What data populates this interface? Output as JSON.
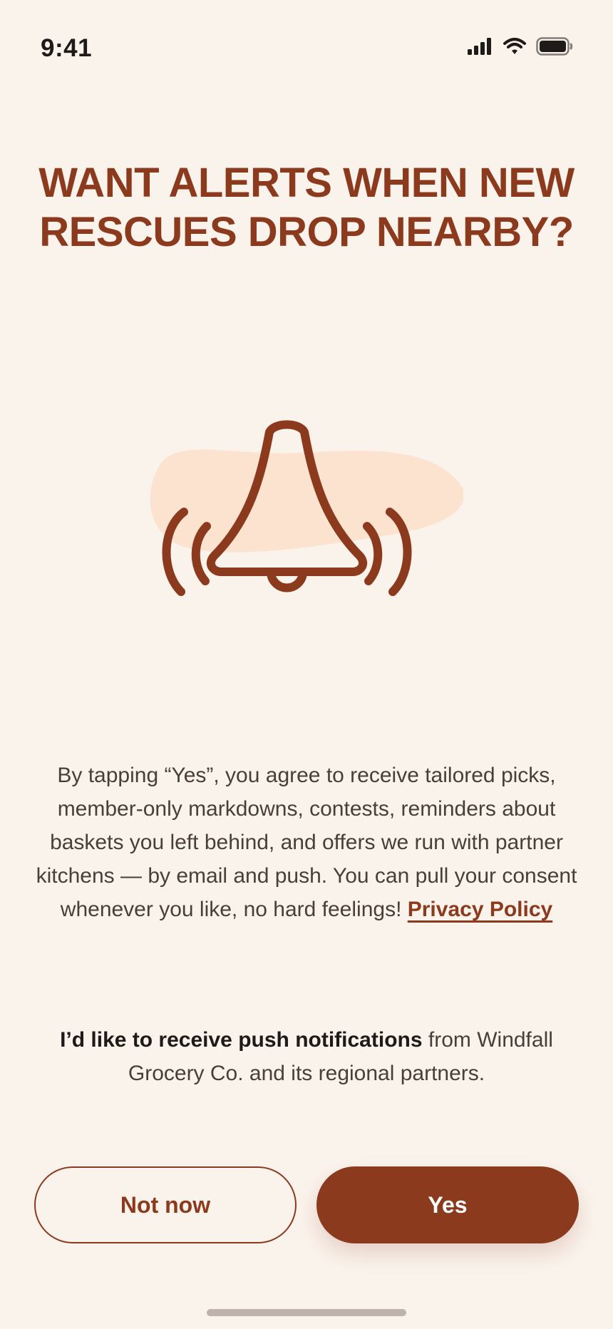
{
  "status_bar": {
    "time": "9:41",
    "icons": [
      "cellular-signal-icon",
      "wifi-icon",
      "battery-icon"
    ]
  },
  "title": "WANT ALERTS WHEN NEW RESCUES DROP NEARBY?",
  "illustration": {
    "icon": "bell-ringing-icon"
  },
  "consent": {
    "text": "By tapping “Yes”, you agree to receive tailored picks, member-only markdowns, contests, reminders about baskets you left behind, and offers we run with partner kitchens — by email and push. You can pull your consent whenever you like, no hard feelings!",
    "privacy_link": "Privacy Policy"
  },
  "push_opt_in": {
    "bold": "I’d like to receive push notifications",
    "rest": "from Windfall Grocery Co. and its regional partners."
  },
  "buttons": {
    "not_now": "Not now",
    "yes": "Yes"
  },
  "colors": {
    "background": "#FAF3EC",
    "accent": "#8C3A1E",
    "blob": "#FCE3CF",
    "text": "#4A3E38"
  }
}
